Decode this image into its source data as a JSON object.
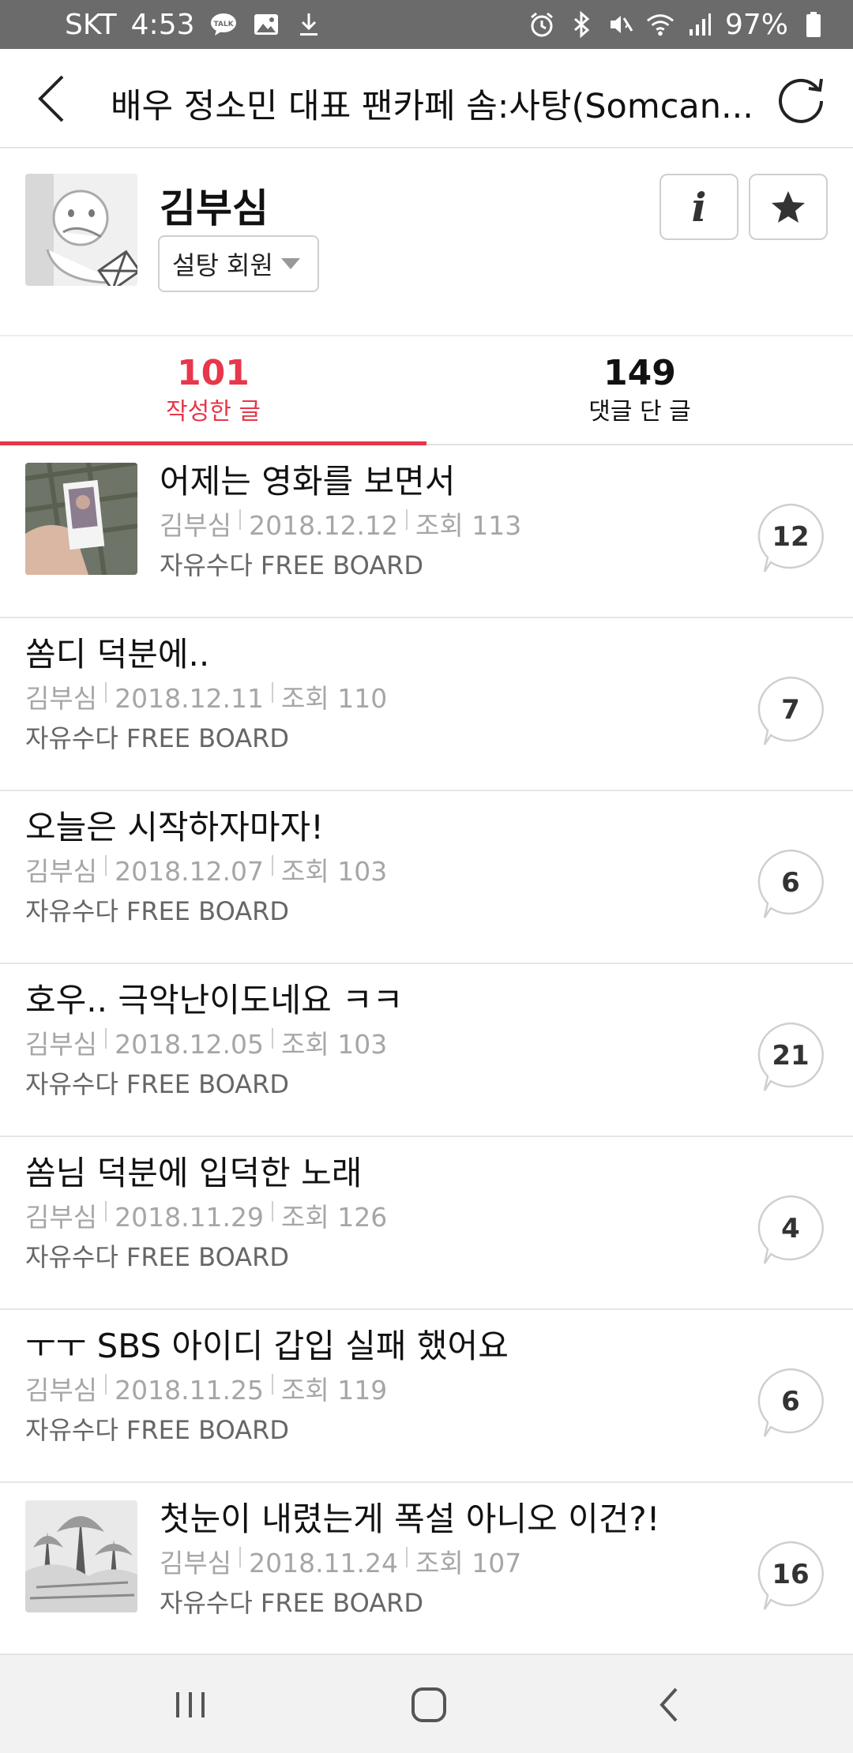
{
  "status_bar": {
    "carrier": "SKT",
    "time": "4:53",
    "battery": "97%",
    "left_icons": [
      "talk-icon",
      "image-icon",
      "download-icon"
    ],
    "right_icons": [
      "alarm-icon",
      "bluetooth-icon",
      "mute-icon",
      "wifi-icon",
      "signal-icon",
      "battery-icon"
    ]
  },
  "app_bar": {
    "title": "배우 정소민 대표 팬카페 솜:사탕(Somcan...",
    "back_icon": "chevron-left-icon",
    "refresh_icon": "refresh-icon"
  },
  "profile": {
    "nickname": "김부심",
    "grade": "설탕 회원",
    "info_label": "i",
    "star_icon": "star-icon"
  },
  "tabs": [
    {
      "count": "101",
      "label": "작성한 글",
      "active": true
    },
    {
      "count": "149",
      "label": "댓글 단 글",
      "active": false
    }
  ],
  "posts": [
    {
      "title": "어제는 영화를 보면서",
      "author": "김부심",
      "date": "2018.12.12",
      "views": "조회 113",
      "board": "자유수다 FREE BOARD",
      "comments": "12",
      "thumbnail": "photo-card"
    },
    {
      "title": "쏨디 덕분에..",
      "author": "김부심",
      "date": "2018.12.11",
      "views": "조회 110",
      "board": "자유수다 FREE BOARD",
      "comments": "7",
      "thumbnail": null
    },
    {
      "title": "오늘은 시작하자마자!",
      "author": "김부심",
      "date": "2018.12.07",
      "views": "조회 103",
      "board": "자유수다 FREE BOARD",
      "comments": "6",
      "thumbnail": null
    },
    {
      "title": "호우.. 극악난이도네요 ㅋㅋ",
      "author": "김부심",
      "date": "2018.12.05",
      "views": "조회 103",
      "board": "자유수다 FREE BOARD",
      "comments": "21",
      "thumbnail": null
    },
    {
      "title": "쏨님 덕분에 입덕한 노래",
      "author": "김부심",
      "date": "2018.11.29",
      "views": "조회 126",
      "board": "자유수다 FREE BOARD",
      "comments": "4",
      "thumbnail": null
    },
    {
      "title": "ㅜㅜ SBS 아이디 갑입 실패 했어요",
      "author": "김부심",
      "date": "2018.11.25",
      "views": "조회 119",
      "board": "자유수다 FREE BOARD",
      "comments": "6",
      "thumbnail": null
    },
    {
      "title": "첫눈이 내렸는게 폭설 아니오 이건?!",
      "author": "김부심",
      "date": "2018.11.24",
      "views": "조회 107",
      "board": "자유수다 FREE BOARD",
      "comments": "16",
      "thumbnail": "snow-trees"
    }
  ],
  "nav_bar": {
    "recents_icon": "recents-icon",
    "home_icon": "home-icon",
    "back_icon": "back-icon"
  },
  "colors": {
    "accent": "#e8364a",
    "status_bar": "#6b6b6b",
    "meta_text": "#a6a6a6",
    "board_text": "#666666"
  }
}
